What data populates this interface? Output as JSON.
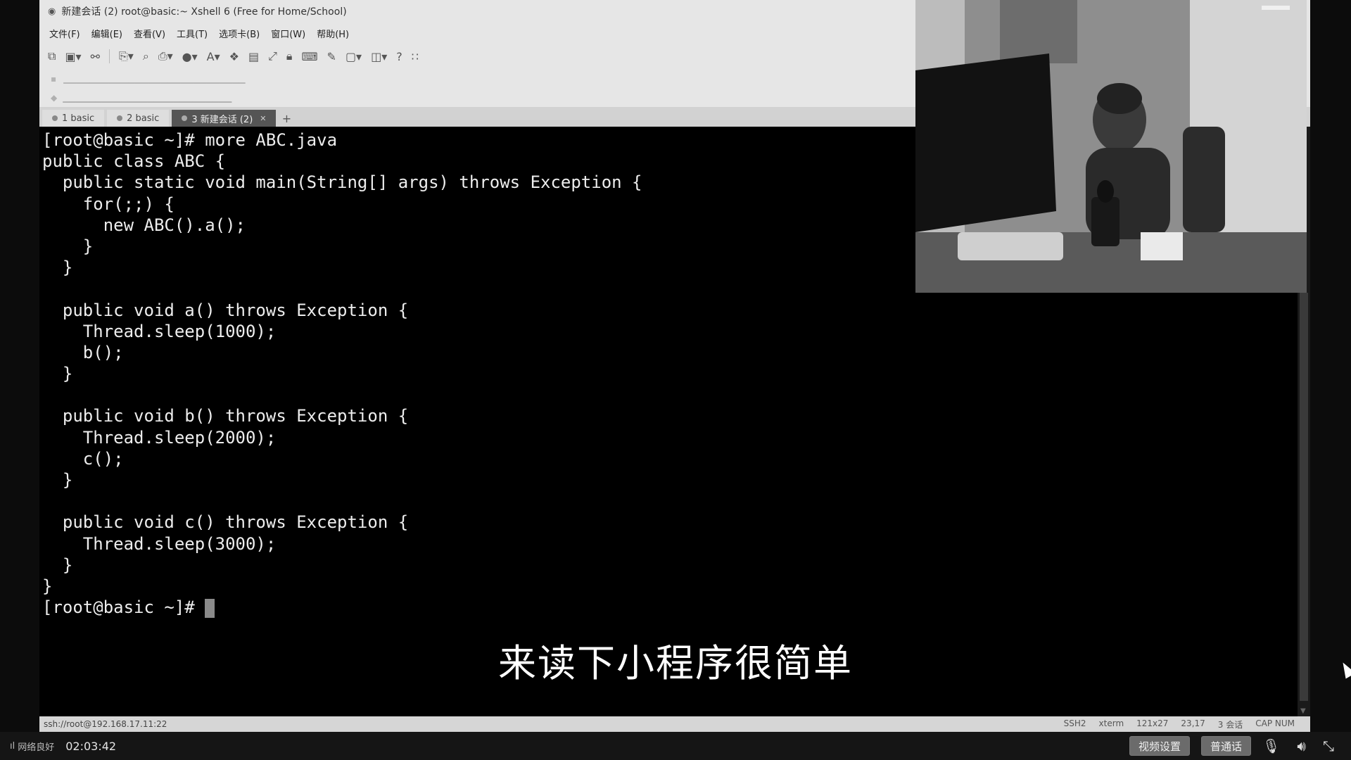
{
  "window": {
    "title": "新建会话 (2)   root@basic:~   Xshell 6 (Free for Home/School)"
  },
  "menu": [
    "文件(F)",
    "编辑(E)",
    "查看(V)",
    "工具(T)",
    "选项卡(B)",
    "窗口(W)",
    "帮助(H)"
  ],
  "tabs": [
    {
      "label": "1 basic",
      "active": false
    },
    {
      "label": "2 basic",
      "active": false
    },
    {
      "label": "3 新建会话 (2)",
      "active": true
    }
  ],
  "terminal": {
    "lines": [
      "[root@basic ~]# more ABC.java",
      "public class ABC {",
      "  public static void main(String[] args) throws Exception {",
      "    for(;;) {",
      "      new ABC().a();",
      "    }",
      "  }",
      "",
      "  public void a() throws Exception {",
      "    Thread.sleep(1000);",
      "    b();",
      "  }",
      "",
      "  public void b() throws Exception {",
      "    Thread.sleep(2000);",
      "    c();",
      "  }",
      "",
      "  public void c() throws Exception {",
      "    Thread.sleep(3000);",
      "  }",
      "}"
    ],
    "prompt": "[root@basic ~]# "
  },
  "statusbar": {
    "path": "ssh://root@192.168.17.11:22",
    "protocol": "SSH2",
    "term": "xterm",
    "size": "121x27",
    "cursor": "23,17",
    "sessions": "3 会话",
    "keys": "CAP NUM"
  },
  "subtitle": "来读下小程序很简单",
  "player": {
    "network": "网络良好",
    "time": "02:03:42",
    "btn_quality": "视频设置",
    "btn_caption": "普通话"
  },
  "colors": {
    "terminal_bg": "#000000",
    "terminal_fg": "#ededed",
    "chrome": "#e6e6e6"
  }
}
